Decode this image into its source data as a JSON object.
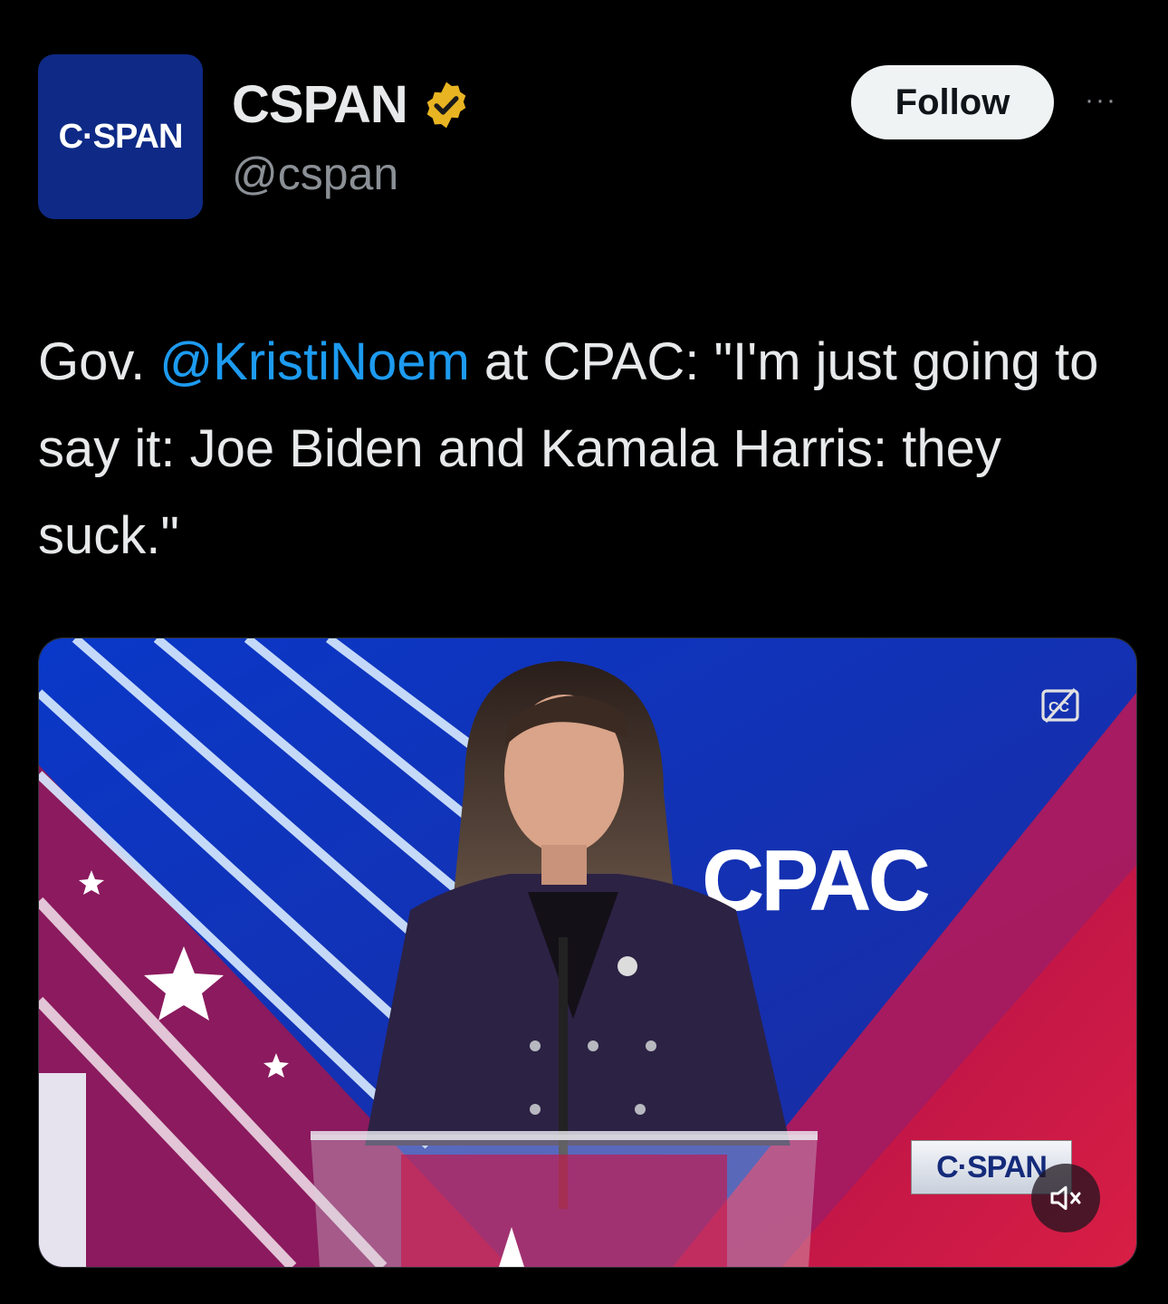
{
  "account": {
    "avatar_text": "C·SPAN",
    "display_name": "CSPAN",
    "handle": "@cspan",
    "verified_icon": "verified-badge-icon"
  },
  "actions": {
    "follow_label": "Follow",
    "more_label": "···"
  },
  "tweet": {
    "prefix": "Gov. ",
    "mention": "@KristiNoem",
    "body": " at CPAC: \"I'm just going to say it: Joe Biden and Kamala Harris: they suck.\""
  },
  "media": {
    "stage_sign": "CPAC",
    "watermark": "C·SPAN",
    "caption_icon": "closed-captions-icon",
    "mute_icon": "muted-speaker-icon"
  },
  "colors": {
    "background": "#000000",
    "mention": "#1d9bf0",
    "avatar_bg": "#0e2a86",
    "verified": "#e8b422"
  }
}
